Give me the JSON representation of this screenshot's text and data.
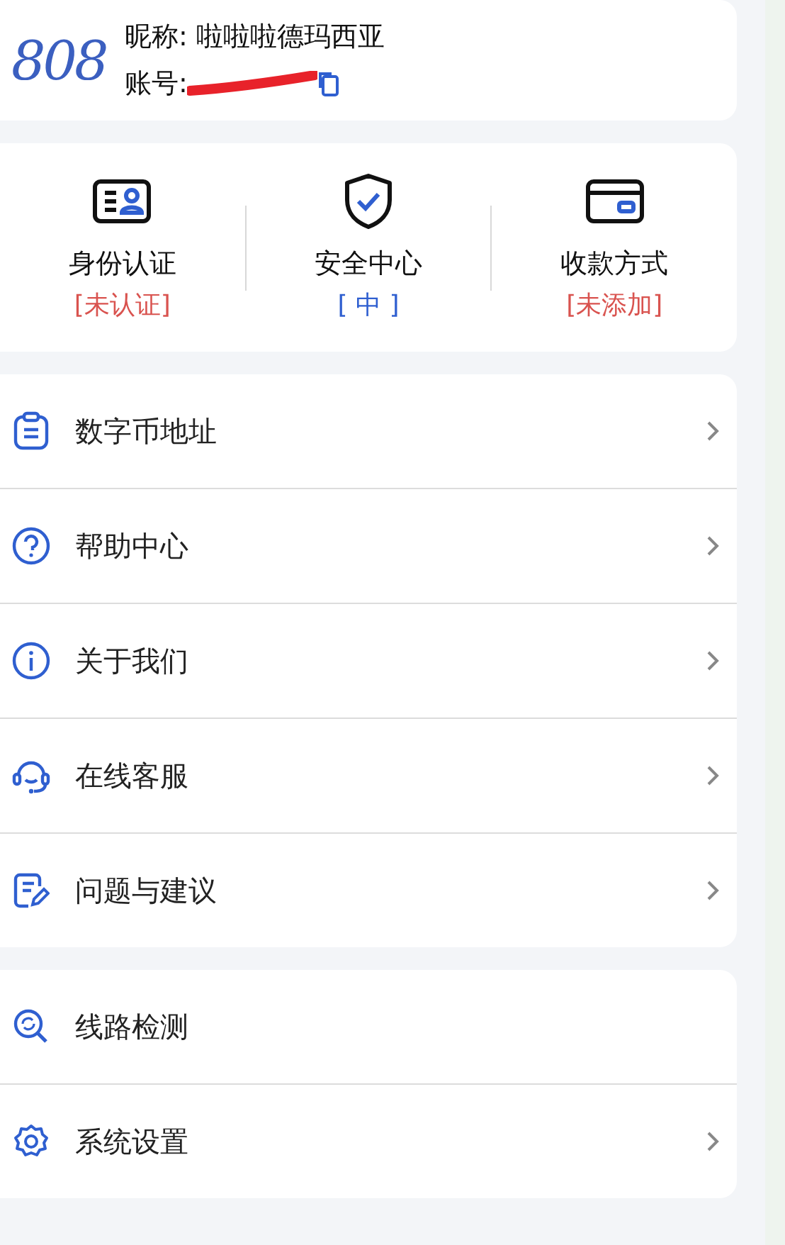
{
  "profile": {
    "logo": "808",
    "nickname": "昵称: 啦啦啦德玛西亚",
    "account_label": "账号:",
    "account_redacted": true
  },
  "shortcuts": [
    {
      "kind": "id",
      "label": "身份认证",
      "status": "[未认证]",
      "color": "#d9534f"
    },
    {
      "kind": "shield",
      "label": "安全中心",
      "status": "[ 中 ]",
      "color": "#2f5fd0"
    },
    {
      "kind": "card",
      "label": "收款方式",
      "status": "[未添加]",
      "color": "#d9534f"
    }
  ],
  "menu_groups": [
    [
      {
        "kind": "clipboard",
        "label": "数字币地址",
        "chevron": true
      },
      {
        "kind": "help",
        "label": "帮助中心",
        "chevron": true
      },
      {
        "kind": "info",
        "label": "关于我们",
        "chevron": true
      },
      {
        "kind": "headset",
        "label": "在线客服",
        "chevron": true
      },
      {
        "kind": "feedback",
        "label": "问题与建议",
        "chevron": true
      }
    ],
    [
      {
        "kind": "network",
        "label": "线路检测",
        "chevron": false
      },
      {
        "kind": "gear",
        "label": "系统设置",
        "chevron": true
      }
    ]
  ]
}
